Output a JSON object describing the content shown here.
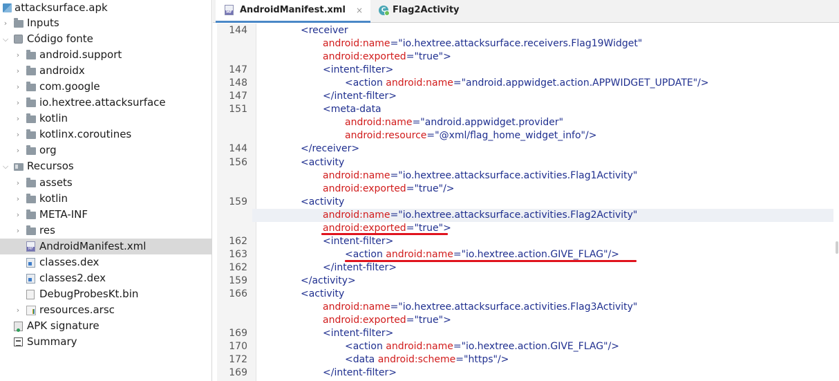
{
  "sidebar": {
    "root_label": "attacksurface.apk",
    "items": [
      {
        "label": "Inputs",
        "icon": "inputs-folder-icon",
        "expanded": false
      },
      {
        "label": "Código fonte",
        "icon": "package-icon",
        "expanded": true
      },
      {
        "label": "android.support",
        "icon": "package-folder-icon",
        "expanded": false
      },
      {
        "label": "androidx",
        "icon": "package-folder-icon",
        "expanded": false
      },
      {
        "label": "com.google",
        "icon": "package-folder-icon",
        "expanded": false
      },
      {
        "label": "io.hextree.attacksurface",
        "icon": "package-folder-icon",
        "expanded": false
      },
      {
        "label": "kotlin",
        "icon": "package-folder-icon",
        "expanded": false
      },
      {
        "label": "kotlinx.coroutines",
        "icon": "package-folder-icon",
        "expanded": false
      },
      {
        "label": "org",
        "icon": "package-folder-icon",
        "expanded": false
      },
      {
        "label": "Recursos",
        "icon": "resources-folder-icon",
        "expanded": true
      },
      {
        "label": "assets",
        "icon": "folder-icon",
        "expanded": false
      },
      {
        "label": "kotlin",
        "icon": "folder-icon",
        "expanded": false
      },
      {
        "label": "META-INF",
        "icon": "folder-icon",
        "expanded": false
      },
      {
        "label": "res",
        "icon": "folder-icon",
        "expanded": false
      },
      {
        "label": "AndroidManifest.xml",
        "icon": "manifest-file-icon",
        "selected": true
      },
      {
        "label": "classes.dex",
        "icon": "dex-file-icon"
      },
      {
        "label": "classes2.dex",
        "icon": "dex-file-icon"
      },
      {
        "label": "DebugProbesKt.bin",
        "icon": "binary-file-icon"
      },
      {
        "label": "resources.arsc",
        "icon": "arsc-file-icon",
        "expanded": false
      },
      {
        "label": "APK signature",
        "icon": "signature-icon"
      },
      {
        "label": "Summary",
        "icon": "summary-icon"
      }
    ]
  },
  "tabs": [
    {
      "label": "AndroidManifest.xml",
      "close": "×",
      "active": true,
      "icon": "manifest-file-icon",
      "badge": "MF"
    },
    {
      "label": "Flag2Activity",
      "active": false,
      "icon": "class-icon",
      "badge": "C"
    }
  ],
  "editor": {
    "lines": [
      {
        "num": "144",
        "indent": 2,
        "parts": [
          [
            "tag",
            "<receiver"
          ]
        ]
      },
      {
        "num": "",
        "indent": 3,
        "parts": [
          [
            "attr",
            "android:name"
          ],
          [
            "eq",
            "="
          ],
          [
            "val",
            "\"io.hextree.attacksurface.receivers.Flag19Widget\""
          ]
        ]
      },
      {
        "num": "",
        "indent": 3,
        "parts": [
          [
            "attr",
            "android:exported"
          ],
          [
            "eq",
            "="
          ],
          [
            "val",
            "\"true\""
          ],
          [
            "tag",
            ">"
          ]
        ]
      },
      {
        "num": "147",
        "indent": 3,
        "parts": [
          [
            "tag",
            "<intent-filter>"
          ]
        ]
      },
      {
        "num": "148",
        "indent": 4,
        "parts": [
          [
            "tag",
            "<action "
          ],
          [
            "attr",
            "android:name"
          ],
          [
            "eq",
            "="
          ],
          [
            "val",
            "\"android.appwidget.action.APPWIDGET_UPDATE\""
          ],
          [
            "tag",
            "/>"
          ]
        ]
      },
      {
        "num": "147",
        "indent": 3,
        "parts": [
          [
            "tag",
            "</intent-filter>"
          ]
        ]
      },
      {
        "num": "151",
        "indent": 3,
        "parts": [
          [
            "tag",
            "<meta-data"
          ]
        ]
      },
      {
        "num": "",
        "indent": 4,
        "parts": [
          [
            "attr",
            "android:name"
          ],
          [
            "eq",
            "="
          ],
          [
            "val",
            "\"android.appwidget.provider\""
          ]
        ]
      },
      {
        "num": "",
        "indent": 4,
        "parts": [
          [
            "attr",
            "android:resource"
          ],
          [
            "eq",
            "="
          ],
          [
            "val",
            "\"@xml/flag_home_widget_info\""
          ],
          [
            "tag",
            "/>"
          ]
        ]
      },
      {
        "num": "144",
        "indent": 2,
        "parts": [
          [
            "tag",
            "</receiver>"
          ]
        ]
      },
      {
        "num": "156",
        "indent": 2,
        "parts": [
          [
            "tag",
            "<activity"
          ]
        ]
      },
      {
        "num": "",
        "indent": 3,
        "parts": [
          [
            "attr",
            "android:name"
          ],
          [
            "eq",
            "="
          ],
          [
            "val",
            "\"io.hextree.attacksurface.activities.Flag1Activity\""
          ]
        ]
      },
      {
        "num": "",
        "indent": 3,
        "parts": [
          [
            "attr",
            "android:exported"
          ],
          [
            "eq",
            "="
          ],
          [
            "val",
            "\"true\""
          ],
          [
            "tag",
            "/>"
          ]
        ]
      },
      {
        "num": "159",
        "indent": 2,
        "parts": [
          [
            "tag",
            "<activity"
          ]
        ]
      },
      {
        "num": "",
        "indent": 3,
        "parts": [
          [
            "attr",
            "android:name"
          ],
          [
            "eq",
            "="
          ],
          [
            "val",
            "\"io.hextree.attacksurface.activities.Flag2Activity\""
          ]
        ],
        "highlight": true
      },
      {
        "num": "",
        "indent": 3,
        "parts": [
          [
            "attr",
            "android:exported"
          ],
          [
            "eq",
            "="
          ],
          [
            "val",
            "\"true\""
          ],
          [
            "tag",
            ">"
          ]
        ]
      },
      {
        "num": "162",
        "indent": 3,
        "parts": [
          [
            "tag",
            "<intent-filter>"
          ]
        ]
      },
      {
        "num": "163",
        "indent": 4,
        "parts": [
          [
            "tag",
            "<action "
          ],
          [
            "attr",
            "android:name"
          ],
          [
            "eq",
            "="
          ],
          [
            "val",
            "\"io.hextree.action.GIVE_FLAG\""
          ],
          [
            "tag",
            "/>"
          ]
        ]
      },
      {
        "num": "162",
        "indent": 3,
        "parts": [
          [
            "tag",
            "</intent-filter>"
          ]
        ]
      },
      {
        "num": "159",
        "indent": 2,
        "parts": [
          [
            "tag",
            "</activity>"
          ]
        ]
      },
      {
        "num": "166",
        "indent": 2,
        "parts": [
          [
            "tag",
            "<activity"
          ]
        ]
      },
      {
        "num": "",
        "indent": 3,
        "parts": [
          [
            "attr",
            "android:name"
          ],
          [
            "eq",
            "="
          ],
          [
            "val",
            "\"io.hextree.attacksurface.activities.Flag3Activity\""
          ]
        ]
      },
      {
        "num": "",
        "indent": 3,
        "parts": [
          [
            "attr",
            "android:exported"
          ],
          [
            "eq",
            "="
          ],
          [
            "val",
            "\"true\""
          ],
          [
            "tag",
            ">"
          ]
        ]
      },
      {
        "num": "169",
        "indent": 3,
        "parts": [
          [
            "tag",
            "<intent-filter>"
          ]
        ]
      },
      {
        "num": "170",
        "indent": 4,
        "parts": [
          [
            "tag",
            "<action "
          ],
          [
            "attr",
            "android:name"
          ],
          [
            "eq",
            "="
          ],
          [
            "val",
            "\"io.hextree.action.GIVE_FLAG\""
          ],
          [
            "tag",
            "/>"
          ]
        ]
      },
      {
        "num": "172",
        "indent": 4,
        "parts": [
          [
            "tag",
            "<data "
          ],
          [
            "attr",
            "android:scheme"
          ],
          [
            "eq",
            "="
          ],
          [
            "val",
            "\"https\""
          ],
          [
            "tag",
            "/>"
          ]
        ]
      },
      {
        "num": "169",
        "indent": 3,
        "parts": [
          [
            "tag",
            "</intent-filter>"
          ]
        ]
      }
    ]
  },
  "colors": {
    "tag": "#1f2f8f",
    "attr": "#d11b1b",
    "annotation": "#e0141e",
    "selected_row": "#d9d9d9",
    "active_tab_underline": "#4a88c7"
  }
}
